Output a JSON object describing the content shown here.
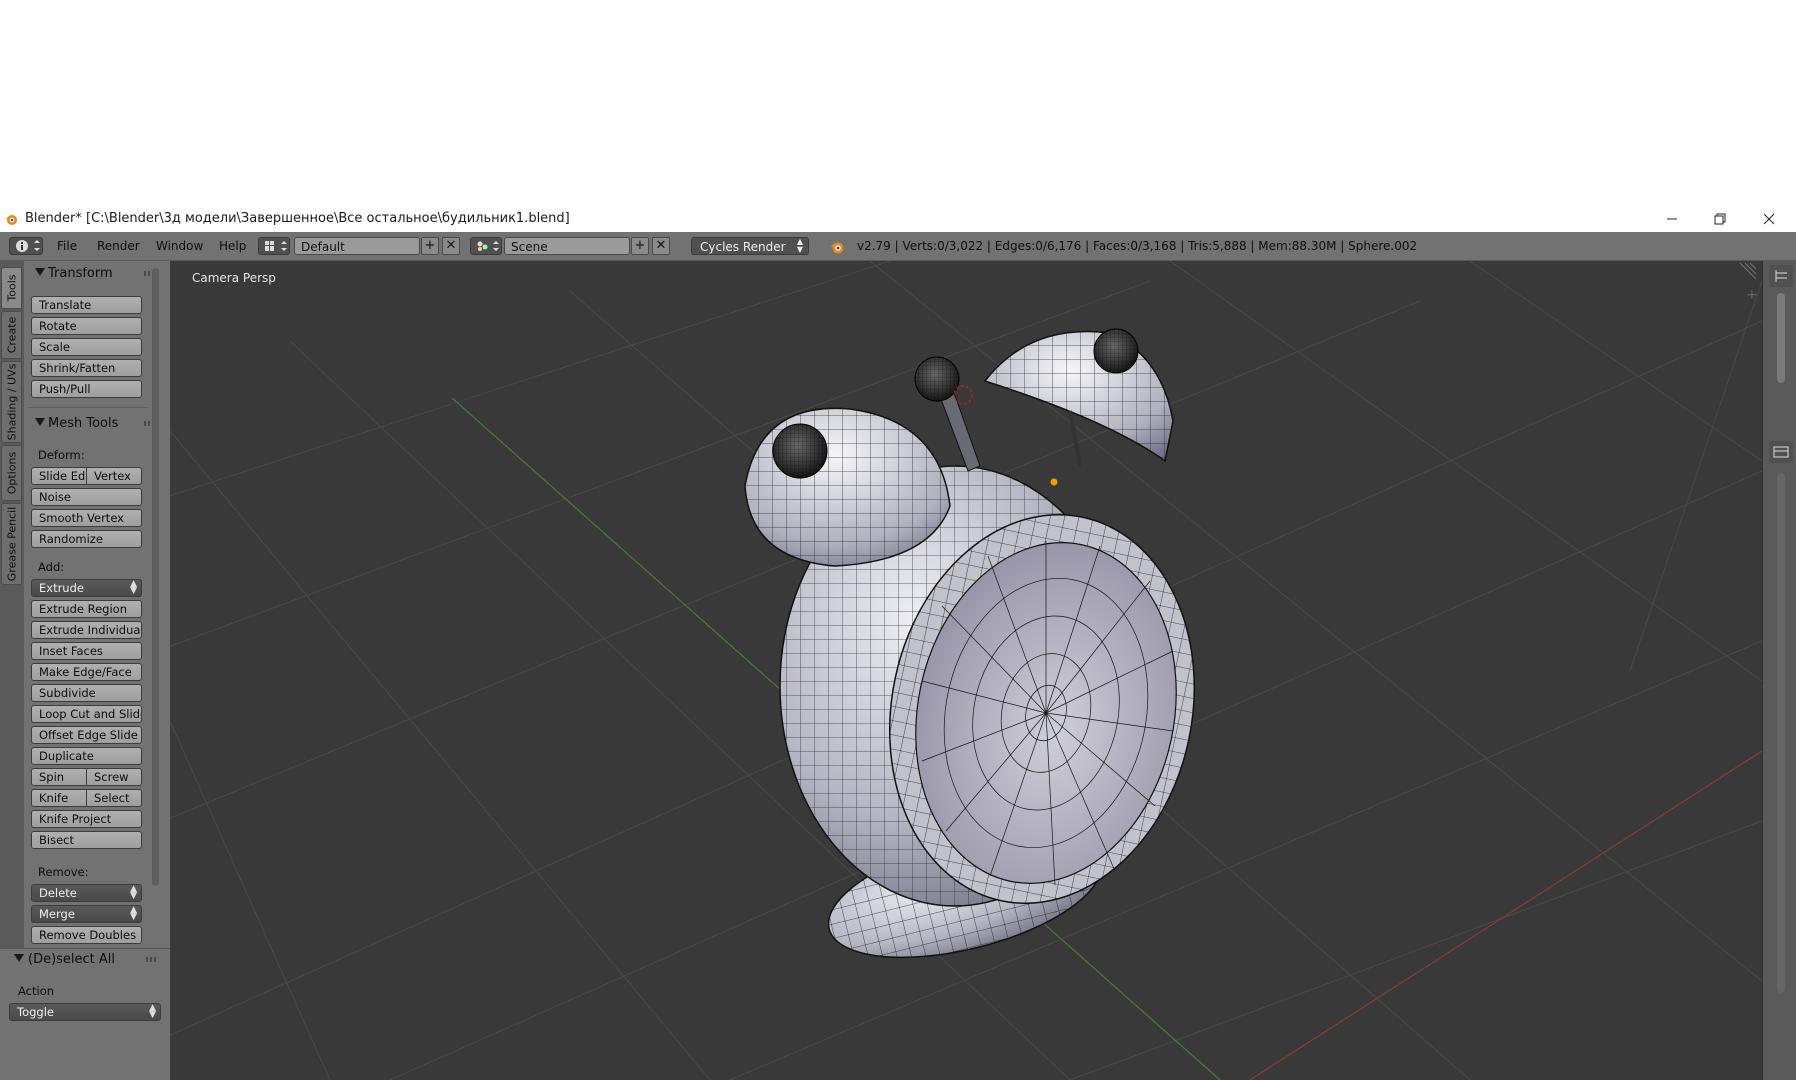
{
  "window": {
    "title": "Blender* [C:\\Blender\\3д модели\\Завершенное\\Все остальное\\будильник1.blend]",
    "minimize_icon": "minimize-icon",
    "maximize_icon": "restore-icon",
    "close_icon": "close-icon"
  },
  "header": {
    "menus": [
      "File",
      "Render",
      "Window",
      "Help"
    ],
    "screen_layout": "Default",
    "scene": "Scene",
    "render_engine": "Cycles Render",
    "stats": "v2.79 | Verts:0/3,022 | Edges:0/6,176 | Faces:0/3,168 | Tris:5,888 | Mem:88.30M | Sphere.002"
  },
  "tabs": [
    "Tools",
    "Create",
    "Shading / UVs",
    "Options",
    "Grease Pencil"
  ],
  "transform": {
    "title": "Transform",
    "buttons": [
      "Translate",
      "Rotate",
      "Scale",
      "Shrink/Fatten",
      "Push/Pull"
    ]
  },
  "mesh_tools": {
    "title": "Mesh Tools",
    "deform_label": "Deform:",
    "slide_edge": "Slide Ed",
    "vertex": "Vertex",
    "noise": "Noise",
    "smooth_vertex": "Smooth Vertex",
    "randomize": "Randomize",
    "add_label": "Add:",
    "extrude": "Extrude",
    "extrude_region": "Extrude Region",
    "extrude_individual": "Extrude Individual",
    "inset_faces": "Inset Faces",
    "make_edge_face": "Make Edge/Face",
    "subdivide": "Subdivide",
    "loop_cut": "Loop Cut and Slide",
    "offset_edge": "Offset Edge Slide",
    "duplicate": "Duplicate",
    "spin": "Spin",
    "screw": "Screw",
    "knife": "Knife",
    "select": "Select",
    "knife_project": "Knife Project",
    "bisect": "Bisect",
    "remove_label": "Remove:",
    "delete": "Delete",
    "merge": "Merge",
    "remove_doubles": "Remove Doubles"
  },
  "redo_panel": {
    "title": "(De)select All",
    "action_label": "Action",
    "action_value": "Toggle"
  },
  "viewport": {
    "label": "Camera Persp"
  },
  "colors": {
    "viewport_bg": "#393939",
    "panel_bg": "#727272",
    "grid_line": "#4a4a4a",
    "x_axis": "#8c3a3a",
    "y_axis": "#4c7a36",
    "mesh_fill": "#c9c9d2",
    "wire": "#111111"
  }
}
